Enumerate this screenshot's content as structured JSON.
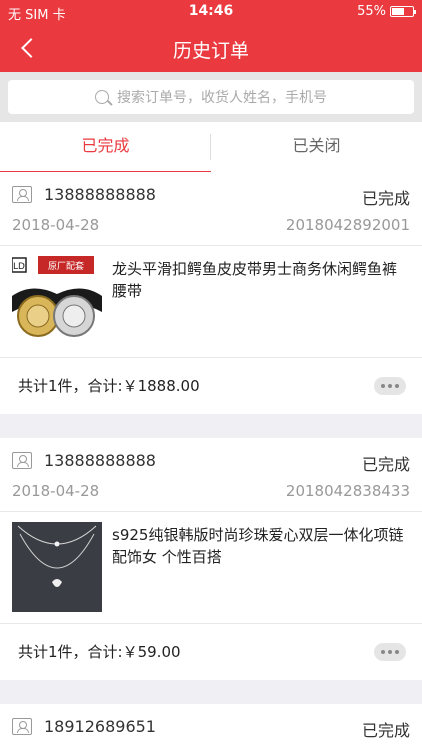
{
  "status_bar": {
    "carrier": "无 SIM 卡",
    "time": "14:46",
    "battery": "55%"
  },
  "nav": {
    "title": "历史订单"
  },
  "search": {
    "placeholder": "搜索订单号，收货人姓名，手机号"
  },
  "tabs": [
    {
      "label": "已完成",
      "active": true
    },
    {
      "label": "已关闭",
      "active": false
    }
  ],
  "orders": [
    {
      "phone": "13888888888",
      "status": "已完成",
      "date": "2018-04-28",
      "order_no": "2018042892001",
      "product": "龙头平滑扣鳄鱼皮皮带男士商务休闲鳄鱼裤腰带",
      "product_badge": "原厂配套",
      "product_brand": "LD",
      "total": "共计1件，合计:￥1888.00"
    },
    {
      "phone": "13888888888",
      "status": "已完成",
      "date": "2018-04-28",
      "order_no": "2018042838433",
      "product": "s925纯银韩版时尚珍珠爱心双层一体化项链配饰女 个性百搭",
      "total": "共计1件，合计:￥59.00"
    },
    {
      "phone": "18912689651",
      "status": "已完成"
    }
  ],
  "colors": {
    "brand": "#ea3a3f",
    "text": "#333333",
    "muted": "#999999",
    "background": "#efeff4"
  }
}
